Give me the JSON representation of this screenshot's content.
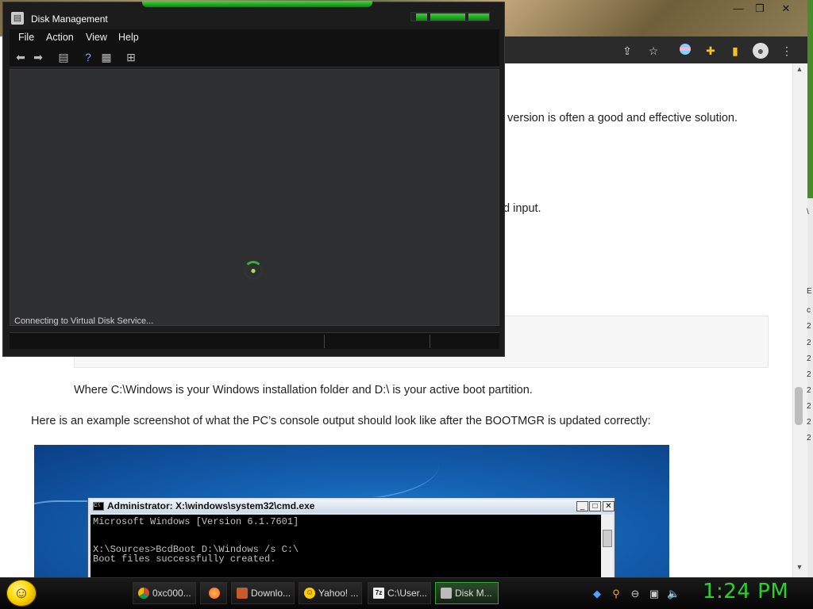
{
  "browser": {
    "toolbar_icons": [
      "share-icon",
      "star-icon",
      "extension-flag-icon",
      "puzzle-icon",
      "sidepanel-icon",
      "profile-icon",
      "menu-icon"
    ],
    "window_controls": [
      "minimize",
      "restore",
      "close"
    ]
  },
  "article": {
    "line1": "t version is often a good and effective solution.",
    "line2": "d input.",
    "line3": "Where C:\\Windows is your Windows installation folder and D:\\ is your active boot partition.",
    "line4": "Here is an example screenshot of what the PC’s console output should look like after the BOOTMGR is updated correctly:"
  },
  "cmd": {
    "title": "Administrator: X:\\windows\\system32\\cmd.exe",
    "icon_text": "C:\\",
    "lines": [
      "Microsoft Windows [Version 6.1.7601]",
      "",
      "X:\\Sources>BcdBoot D:\\Windows /s C:\\",
      "Boot files successfully created."
    ]
  },
  "disk_management": {
    "title": "Disk Management",
    "menu": [
      "File",
      "Action",
      "View",
      "Help"
    ],
    "status_message": "Connecting to Virtual Disk Service..."
  },
  "right_window": {
    "labels": [
      "\\",
      "E",
      "c",
      "2",
      "2",
      "2",
      "2",
      "2",
      "2",
      "2",
      "2"
    ]
  },
  "taskbar": {
    "tasks": [
      {
        "label": "0xc000...",
        "icon": "chrome-icon",
        "color": "#e8b62c"
      },
      {
        "label": "",
        "icon": "firefox-icon",
        "color": "#ff7a1a"
      },
      {
        "label": "Downlo...",
        "icon": "download-icon",
        "color": "#c75b2a"
      },
      {
        "label": "Yahoo! ...",
        "icon": "yahoo-icon",
        "color": "#ffcc00"
      },
      {
        "label": "C:\\User...",
        "icon": "7zip-icon",
        "color": "#dddddd"
      },
      {
        "label": "Disk M...",
        "icon": "disk-management-icon",
        "color": "#bbbbbb"
      }
    ],
    "clock": "1:24 PM"
  },
  "colors": {
    "accent_green": "#2bd12b",
    "dm_background": "#2d2f31",
    "page_background": "#ffffff"
  }
}
